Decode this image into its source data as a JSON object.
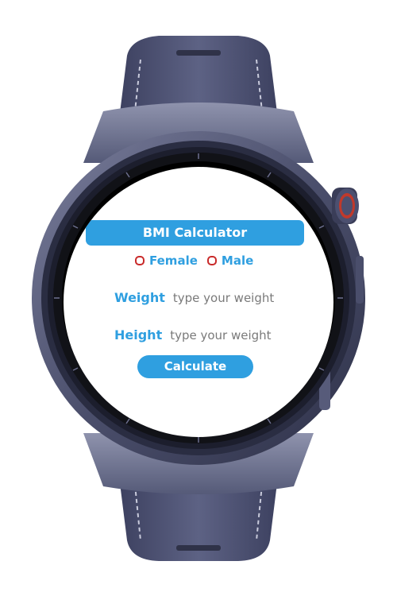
{
  "app": {
    "title": "BMI Calculator"
  },
  "gender": {
    "female_label": "Female",
    "male_label": "Male"
  },
  "weight": {
    "label": "Weight",
    "placeholder": "type your weight"
  },
  "height": {
    "label": "Height",
    "placeholder": "type your weight"
  },
  "actions": {
    "calculate_label": "Calculate"
  },
  "colors": {
    "accent": "#2f9fe0",
    "radio_border": "#c92a2a",
    "watch_body": "#4a4e6b"
  }
}
